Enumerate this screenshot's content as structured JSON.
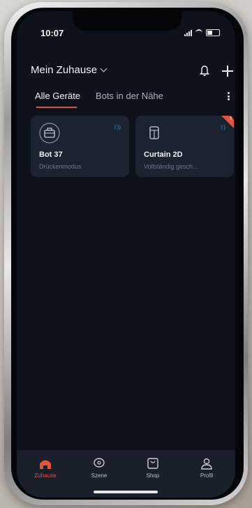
{
  "status_bar": {
    "time": "10:07"
  },
  "header": {
    "home_title": "Mein Zuhause"
  },
  "tabs": [
    {
      "label": "Alle Geräte",
      "active": true
    },
    {
      "label": "Bots in der Nähe",
      "active": false
    }
  ],
  "devices": [
    {
      "name": "Bot 37",
      "status": "Drückenmodus",
      "connection_icon": "bluetooth-icon",
      "icon": "bot-icon"
    },
    {
      "name": "Curtain 2D",
      "status": "Vollständig gesch...",
      "connection_icon": "bluetooth-icon",
      "icon": "curtain-icon",
      "badge": "!"
    }
  ],
  "bottom_nav": [
    {
      "label": "Zuhause",
      "icon": "home-icon",
      "active": true
    },
    {
      "label": "Szene",
      "icon": "scene-icon",
      "active": false
    },
    {
      "label": "Shop",
      "icon": "shop-icon",
      "active": false
    },
    {
      "label": "Profil",
      "icon": "profile-icon",
      "active": false
    }
  ],
  "colors": {
    "accent": "#e2533f",
    "background": "#0d111a",
    "card": "#1b2230",
    "bluetooth": "#3c8ee5"
  }
}
